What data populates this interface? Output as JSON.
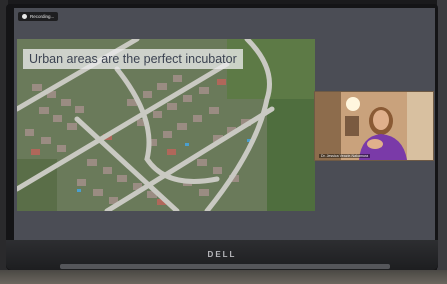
{
  "recording": {
    "label": "Recording..."
  },
  "slide": {
    "title": "Urban areas are the perfect incubator"
  },
  "participant": {
    "name": "Dr. Jessica Veazie-Nakamura"
  },
  "device": {
    "brand": "DELL"
  },
  "colors": {
    "screen_background": "#4b4d55",
    "title_box": "#ebebeb",
    "title_text": "#3c4352",
    "speaker_shirt": "#7a3aa8"
  }
}
